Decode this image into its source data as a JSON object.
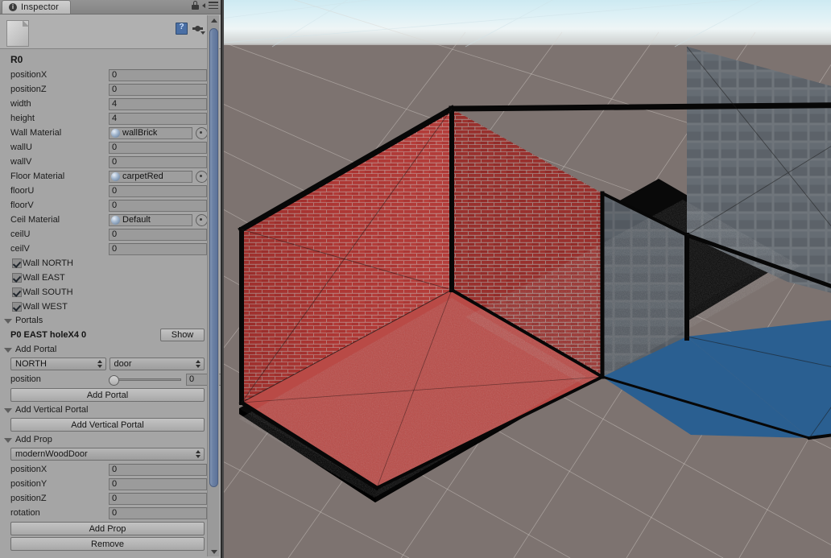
{
  "window": {
    "tab_label": "Inspector",
    "tab_badge": "i",
    "lock_icon": "lock-icon",
    "menu_icon": "hamburger-menu-icon",
    "help_icon": "help-book-icon",
    "settings_icon": "gear-icon",
    "script_icon": "script-asset-icon"
  },
  "inspector": {
    "object_title": "R0",
    "fields": [
      {
        "label": "positionX",
        "value": "0",
        "type": "number"
      },
      {
        "label": "positionZ",
        "value": "0",
        "type": "number"
      },
      {
        "label": "width",
        "value": "4",
        "type": "number"
      },
      {
        "label": "height",
        "value": "4",
        "type": "number"
      },
      {
        "label": "Wall Material",
        "value": "wallBrick",
        "type": "object"
      },
      {
        "label": "wallU",
        "value": "0",
        "type": "number"
      },
      {
        "label": "wallV",
        "value": "0",
        "type": "number"
      },
      {
        "label": "Floor Material",
        "value": "carpetRed",
        "type": "object"
      },
      {
        "label": "floorU",
        "value": "0",
        "type": "number"
      },
      {
        "label": "floorV",
        "value": "0",
        "type": "number"
      },
      {
        "label": "Ceil Material",
        "value": "Default",
        "type": "object"
      },
      {
        "label": "ceilU",
        "value": "0",
        "type": "number"
      },
      {
        "label": "ceilV",
        "value": "0",
        "type": "number"
      }
    ],
    "wall_toggles": [
      {
        "label": "Wall NORTH",
        "checked": true
      },
      {
        "label": "Wall EAST",
        "checked": true
      },
      {
        "label": "Wall SOUTH",
        "checked": true
      },
      {
        "label": "Wall WEST",
        "checked": true
      }
    ],
    "portals_section": {
      "header": "Portals",
      "entry_label": "P0 EAST holeX4 0",
      "show_button": "Show"
    },
    "add_portal_section": {
      "header": "Add Portal",
      "direction_value": "NORTH",
      "type_value": "door",
      "position_label": "position",
      "position_value": "0",
      "position_slider_pct": 0,
      "button": "Add Portal"
    },
    "add_vertical_portal_section": {
      "header": "Add Vertical Portal",
      "button": "Add Vertical Portal"
    },
    "add_prop_section": {
      "header": "Add Prop",
      "prop_value": "modernWoodDoor",
      "fields": [
        {
          "label": "positionX",
          "value": "0"
        },
        {
          "label": "positionY",
          "value": "0"
        },
        {
          "label": "positionZ",
          "value": "0"
        },
        {
          "label": "rotation",
          "value": "0"
        }
      ],
      "add_button": "Add Prop",
      "remove_button": "Remove"
    }
  },
  "viewport": {
    "name": "scene-3d-viewport",
    "sky_top_color": "#cdeaf2",
    "ground_color": "#7d7370",
    "room": {
      "wall_material": "brick-red",
      "tile_material": "tile-gray",
      "floor_left_color": "#c0504a",
      "floor_right_color": "#2f6699",
      "outline_color": "#0a0a0a"
    }
  }
}
